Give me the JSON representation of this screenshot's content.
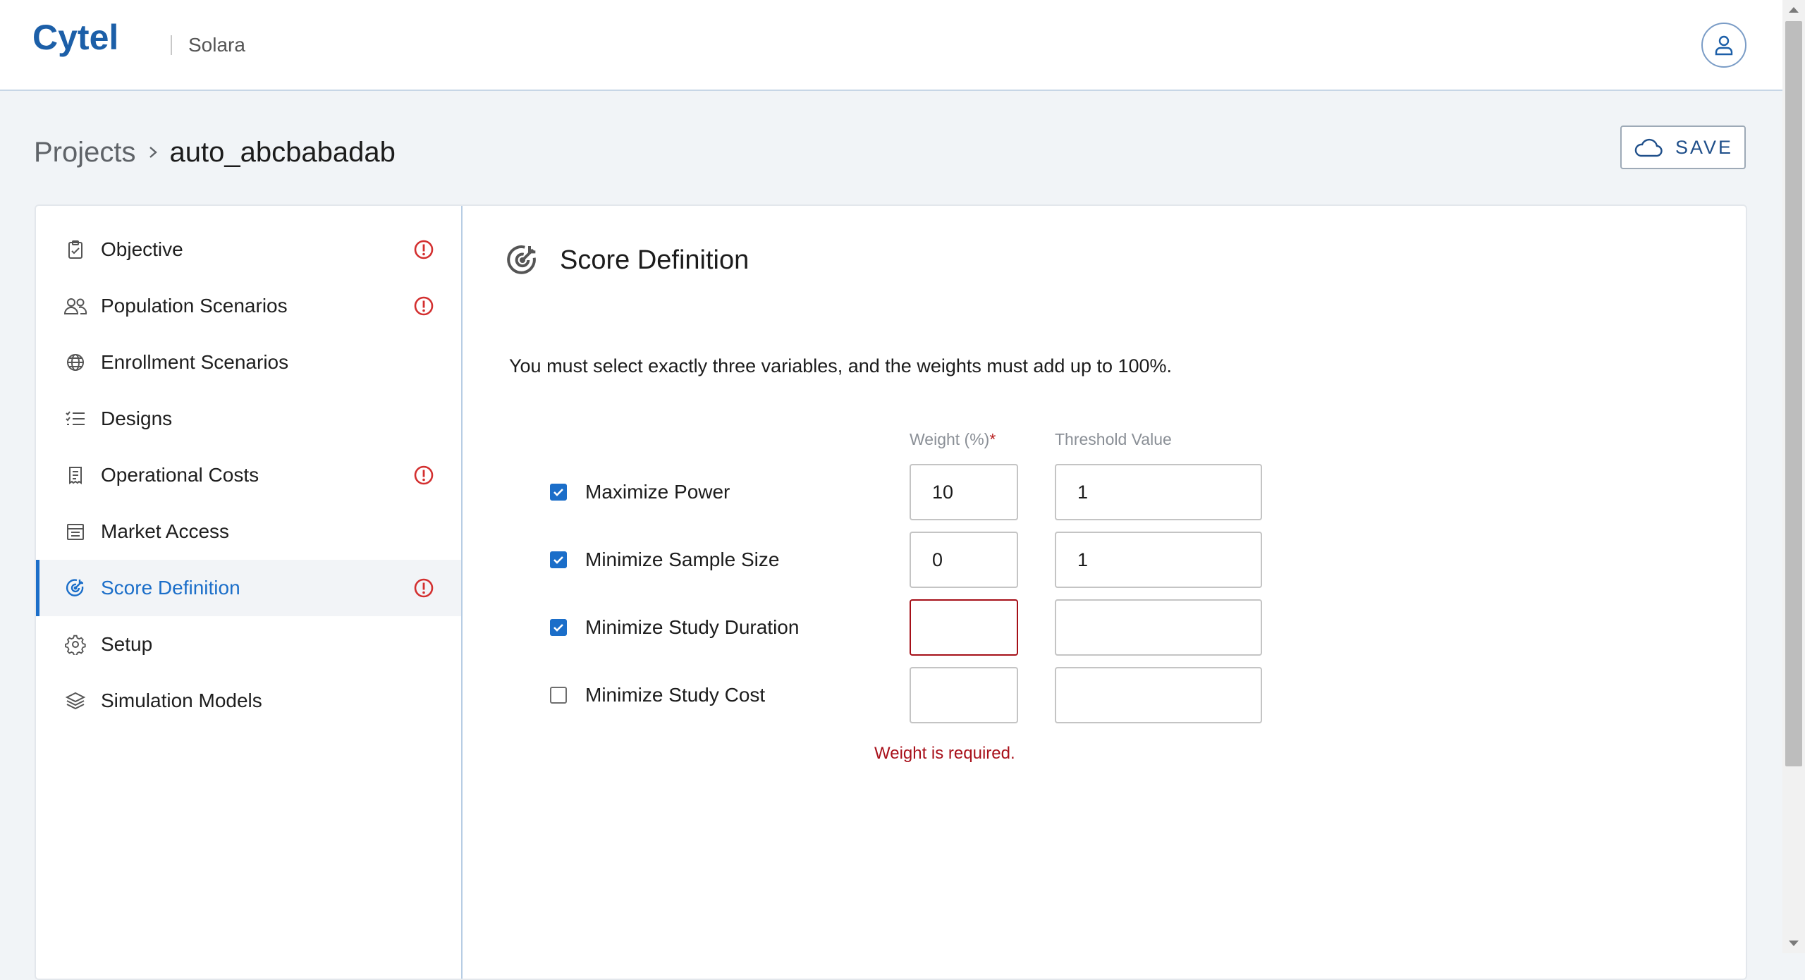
{
  "header": {
    "brand": "Cytel",
    "app_name": "Solara",
    "user_icon": "user-icon"
  },
  "breadcrumb": {
    "root": "Projects",
    "current": "auto_abcbabadab"
  },
  "toolbar": {
    "save_label": "SAVE",
    "save_icon": "cloud-icon"
  },
  "colors": {
    "accent": "#1b6ec9",
    "error": "#a8101a",
    "warning_icon": "#d32f2f"
  },
  "sidebar": {
    "items": [
      {
        "label": "Objective",
        "icon": "clipboard-check-icon",
        "warning": true
      },
      {
        "label": "Population Scenarios",
        "icon": "people-icon",
        "warning": true
      },
      {
        "label": "Enrollment Scenarios",
        "icon": "globe-icon",
        "warning": false
      },
      {
        "label": "Designs",
        "icon": "checklist-icon",
        "warning": false
      },
      {
        "label": "Operational Costs",
        "icon": "receipt-icon",
        "warning": true
      },
      {
        "label": "Market Access",
        "icon": "building-icon",
        "warning": false
      },
      {
        "label": "Score Definition",
        "icon": "target-icon",
        "warning": true,
        "active": true
      },
      {
        "label": "Setup",
        "icon": "gear-icon",
        "warning": false
      },
      {
        "label": "Simulation Models",
        "icon": "layers-icon",
        "warning": false
      }
    ]
  },
  "main": {
    "title": "Score Definition",
    "instructions": "You must select exactly three variables, and the weights must add up to 100%.",
    "columns": {
      "weight": "Weight (%)",
      "weight_required_mark": "*",
      "threshold": "Threshold Value"
    },
    "rows": [
      {
        "label": "Maximize Power",
        "checked": true,
        "weight": "10",
        "threshold": "1"
      },
      {
        "label": "Minimize Sample Size",
        "checked": true,
        "weight": "0",
        "threshold": "1"
      },
      {
        "label": "Minimize Study Duration",
        "checked": true,
        "weight": "",
        "threshold": "",
        "weight_error": true
      },
      {
        "label": "Minimize Study Cost",
        "checked": false,
        "weight": "",
        "threshold": ""
      }
    ],
    "error_message": "Weight is required."
  }
}
